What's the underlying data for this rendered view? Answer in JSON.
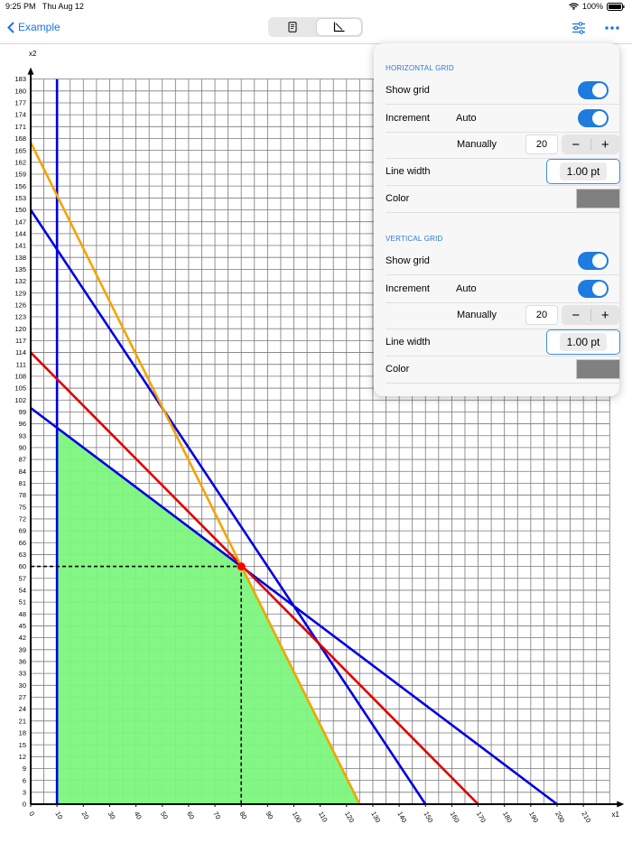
{
  "status": {
    "time": "9:25 PM",
    "date": "Thu Aug 12",
    "battery": "100%"
  },
  "nav": {
    "back_label": "Example"
  },
  "colors": {
    "accent": "#1a73e8",
    "constraint_blue": "#0000e0",
    "constraint_red": "#e00000",
    "constraint_orange": "#f5a300",
    "feasible": "#7cf57c",
    "optimum": "#ff0000"
  },
  "chart_data": {
    "type": "line",
    "xlabel": "x1",
    "ylabel": "x2",
    "xlim": [
      0,
      220
    ],
    "ylim": [
      0,
      183
    ],
    "x_ticks": [
      0,
      10,
      20,
      30,
      40,
      50,
      60,
      70,
      80,
      90,
      100,
      110,
      120,
      130,
      140,
      150,
      160,
      170,
      180,
      190,
      200,
      210
    ],
    "y_ticks": [
      0,
      3,
      6,
      9,
      12,
      15,
      18,
      21,
      24,
      27,
      30,
      33,
      36,
      39,
      42,
      45,
      48,
      51,
      54,
      57,
      60,
      63,
      66,
      69,
      72,
      75,
      78,
      81,
      84,
      87,
      90,
      93,
      96,
      99,
      102,
      105,
      108,
      111,
      114,
      117,
      120,
      123,
      126,
      129,
      132,
      135,
      138,
      141,
      144,
      147,
      150,
      153,
      156,
      159,
      162,
      165,
      168,
      171,
      174,
      177,
      180,
      183
    ],
    "series": [
      {
        "color": "#0000e0",
        "points": [
          [
            10,
            0
          ],
          [
            10,
            183
          ]
        ]
      },
      {
        "color": "#0000e0",
        "points": [
          [
            0,
            150
          ],
          [
            150,
            0
          ]
        ]
      },
      {
        "color": "#0000e0",
        "points": [
          [
            0,
            100
          ],
          [
            200,
            0
          ]
        ]
      },
      {
        "color": "#e00000",
        "points": [
          [
            0,
            114
          ],
          [
            170,
            0
          ]
        ]
      },
      {
        "color": "#f5a300",
        "points": [
          [
            0,
            167
          ],
          [
            125,
            0
          ]
        ]
      }
    ],
    "feasible_region": [
      [
        10,
        0
      ],
      [
        10,
        95
      ],
      [
        80,
        60
      ],
      [
        125,
        0
      ]
    ],
    "optimum": {
      "x": 80,
      "y": 60
    },
    "grid": true
  },
  "popover": {
    "horizontal": {
      "title": "HORIZONTAL GRID",
      "show_grid": "Show grid",
      "increment": "Increment",
      "auto": "Auto",
      "manually": "Manually",
      "manual_value": "20",
      "line_width": "Line width",
      "line_width_value": "1.00 pt",
      "color": "Color"
    },
    "vertical": {
      "title": "VERTICAL GRID",
      "show_grid": "Show grid",
      "increment": "Increment",
      "auto": "Auto",
      "manually": "Manually",
      "manual_value": "20",
      "line_width": "Line width",
      "line_width_value": "1.00 pt",
      "color": "Color"
    },
    "minus": "−",
    "plus": "+"
  }
}
